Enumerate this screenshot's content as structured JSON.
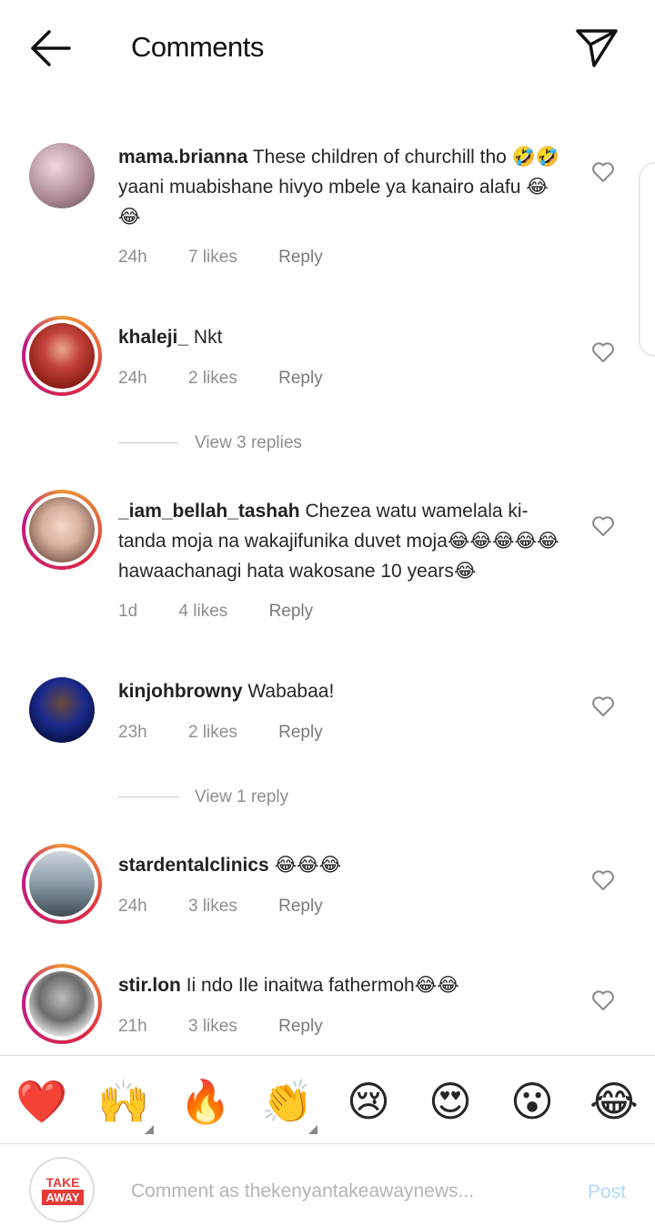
{
  "header": {
    "title": "Comments"
  },
  "comments": [
    {
      "user": "mama.brianna",
      "text": "These children of churchill tho 🤣🤣 yaani muabishane hivyo mbele ya kanairo alafu 😂😂",
      "time": "24h",
      "likes": "7 likes",
      "reply": "Reply"
    },
    {
      "user": "khaleji_",
      "text": "Nkt",
      "time": "24h",
      "likes": "2 likes",
      "reply": "Reply"
    },
    {
      "user": "_iam_bellah_tashah",
      "text": "Chezea watu wamelala ki-tanda moja na wakajifunika duvet moja😂😂😂😂😂hawaachanagi hata wakosane 10 years😂",
      "time": "1d",
      "likes": "4 likes",
      "reply": "Reply"
    },
    {
      "user": "kinjohbrowny",
      "text": "Wababaa!",
      "time": "23h",
      "likes": "2 likes",
      "reply": "Reply"
    },
    {
      "user": "stardentalclinics",
      "text": "😂😂😂",
      "time": "24h",
      "likes": "3 likes",
      "reply": "Reply"
    },
    {
      "user": "stir.lon",
      "text": "Ii ndo Ile inaitwa fathermoh😂😂",
      "time": "21h",
      "likes": "3 likes",
      "reply": "Reply"
    }
  ],
  "view_replies": [
    "View 3 replies",
    "View 1 reply"
  ],
  "emoji_bar": [
    "❤️",
    "🙌",
    "🔥",
    "👏",
    "😢",
    "😍",
    "😮",
    "😂"
  ],
  "composer": {
    "placeholder": "Comment as thekenyantakeawaynews...",
    "post_label": "Post",
    "logo_top": "TAKE",
    "logo_bottom": "AWAY"
  },
  "colors": {
    "post_disabled": "#b4d6f7",
    "story_ring": "#dc2743",
    "muted": "#8e8e8e"
  }
}
